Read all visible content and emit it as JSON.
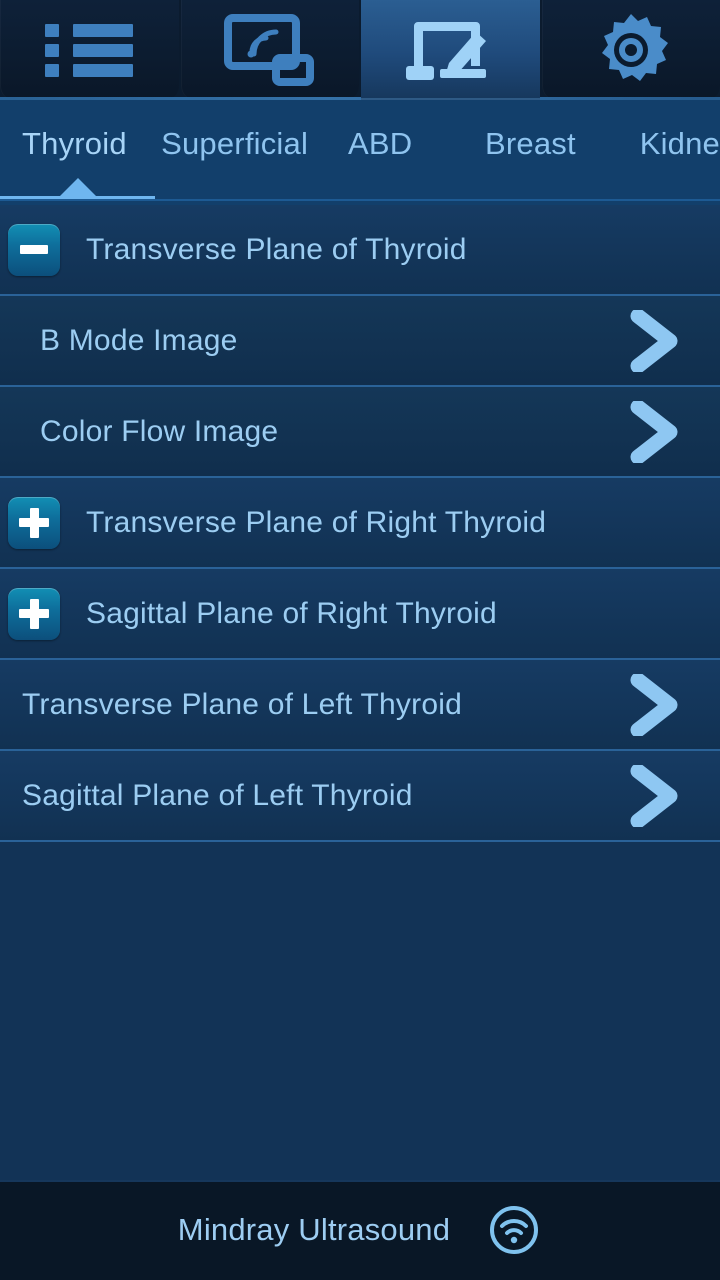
{
  "iconbar": {
    "items": [
      {
        "name": "list-icon",
        "label": "List",
        "active": false
      },
      {
        "name": "cast-screen-icon",
        "label": "Remote Screen",
        "active": false
      },
      {
        "name": "annotate-screen-icon",
        "label": "Annotate",
        "active": true
      },
      {
        "name": "gear-icon",
        "label": "Settings",
        "active": false
      }
    ]
  },
  "tabs": [
    {
      "label": "Thyroid",
      "active": true
    },
    {
      "label": "Superficial",
      "active": false
    },
    {
      "label": "ABD",
      "active": false
    },
    {
      "label": "Breast",
      "active": false
    },
    {
      "label": "Kidne",
      "active": false
    }
  ],
  "list": {
    "rows": [
      {
        "label": "Transverse Plane of Thyroid",
        "toggle": "minus",
        "chevron": false,
        "indent": "parent"
      },
      {
        "label": "B Mode Image",
        "toggle": "none",
        "chevron": true,
        "indent": "child"
      },
      {
        "label": "Color Flow Image",
        "toggle": "none",
        "chevron": true,
        "indent": "child"
      },
      {
        "label": "Transverse Plane of Right Thyroid",
        "toggle": "plus",
        "chevron": false,
        "indent": "parent"
      },
      {
        "label": "Sagittal Plane of Right Thyroid",
        "toggle": "plus",
        "chevron": false,
        "indent": "parent"
      },
      {
        "label": "Transverse Plane of Left Thyroid",
        "toggle": "none",
        "chevron": true,
        "indent": "plain"
      },
      {
        "label": "Sagittal Plane of Left Thyroid",
        "toggle": "none",
        "chevron": true,
        "indent": "plain"
      }
    ]
  },
  "bottombar": {
    "device_label": "Mindray Ultrasound",
    "status_icon": "wifi-circle-icon"
  },
  "colors": {
    "accent": "#6fb6ef",
    "text": "#9ccdf2",
    "toggle_top": "#128fb4",
    "toggle_bottom": "#0c4f7c",
    "page_bg": "#123356",
    "iconbar_bg": "#0b1b2e",
    "tabstrip_bg": "#123f6b",
    "bottombar_bg": "#091726"
  }
}
